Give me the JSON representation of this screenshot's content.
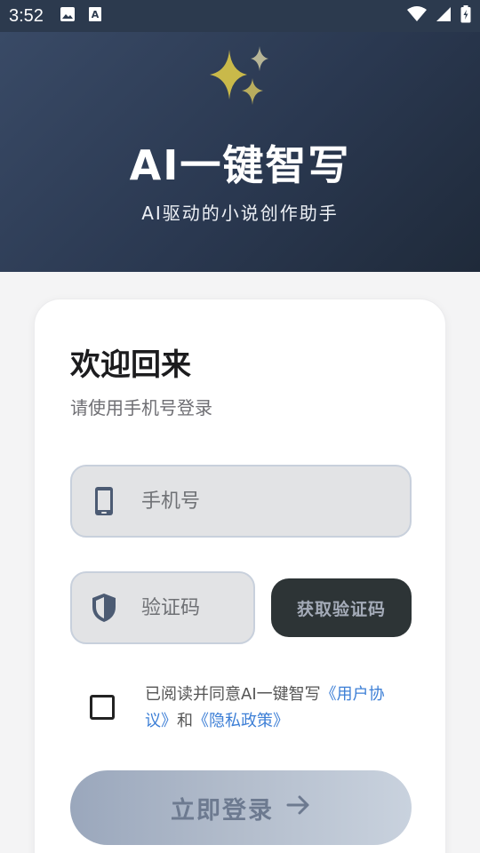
{
  "status_bar": {
    "time": "3:52",
    "left_icons": [
      "image-icon",
      "a-icon"
    ],
    "right_icons": [
      "wifi-icon",
      "signal-icon",
      "battery-icon"
    ]
  },
  "header": {
    "icon": "sparkle-icon",
    "title": "AI一键智写",
    "subtitle": "AI驱动的小说创作助手"
  },
  "login_card": {
    "welcome": "欢迎回来",
    "hint": "请使用手机号登录",
    "phone": {
      "icon": "phone-icon",
      "placeholder": "手机号",
      "value": ""
    },
    "code": {
      "icon": "shield-icon",
      "placeholder": "验证码",
      "value": ""
    },
    "get_code_label": "获取验证码",
    "agreement": {
      "checked": false,
      "prefix": "已阅读并同意AI一键智写",
      "user_agreement": "《用户协议》",
      "and": "和",
      "privacy_policy": "《隐私政策》"
    },
    "login_label": "立即登录",
    "login_icon": "arrow-right-icon"
  },
  "colors": {
    "header_bg": "#2f3d54",
    "accent_link": "#3d7fd6",
    "sparkle": "#c9b94a",
    "button_dark": "#2d3436"
  }
}
